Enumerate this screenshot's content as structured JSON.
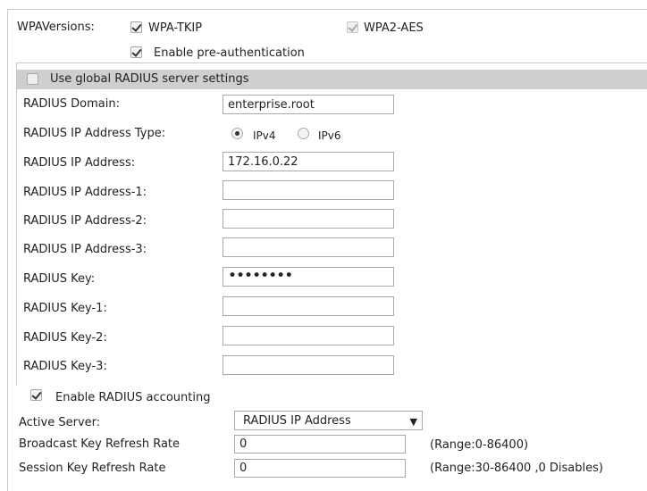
{
  "wpa": {
    "versions_label": "WPAVersions:",
    "tkip_label": "WPA-TKIP",
    "tkip_checked": true,
    "aes_label": "WPA2-AES",
    "aes_checked": true,
    "aes_disabled": true,
    "preauth_label": "Enable pre-authentication",
    "preauth_checked": true
  },
  "radius": {
    "global_label": "Use global RADIUS server settings",
    "global_checked": false,
    "domain_label": "RADIUS Domain:",
    "domain_value": "enterprise.root",
    "ip_type_label": "RADIUS IP Address Type:",
    "ipv4_label": "IPv4",
    "ipv6_label": "IPv6",
    "ip_type_selected": "IPv4",
    "ip_label": "RADIUS IP Address:",
    "ip_value": "172.16.0.22",
    "ip1_label": "RADIUS IP Address-1:",
    "ip1_value": "",
    "ip2_label": "RADIUS IP Address-2:",
    "ip2_value": "",
    "ip3_label": "RADIUS IP Address-3:",
    "ip3_value": "",
    "key_label": "RADIUS Key:",
    "key_value": "••••••••",
    "key1_label": "RADIUS Key-1:",
    "key1_value": "",
    "key2_label": "RADIUS Key-2:",
    "key2_value": "",
    "key3_label": "RADIUS Key-3:",
    "key3_value": "",
    "accounting_label": "Enable RADIUS accounting",
    "accounting_checked": true
  },
  "server": {
    "active_label": "Active Server:",
    "active_value": "RADIUS IP Address",
    "broadcast_label": "Broadcast Key Refresh Rate",
    "broadcast_value": "0",
    "broadcast_range": "(Range:0-86400)",
    "session_label": "Session Key Refresh Rate",
    "session_value": "0",
    "session_range": "(Range:30-86400 ,0 Disables)"
  }
}
